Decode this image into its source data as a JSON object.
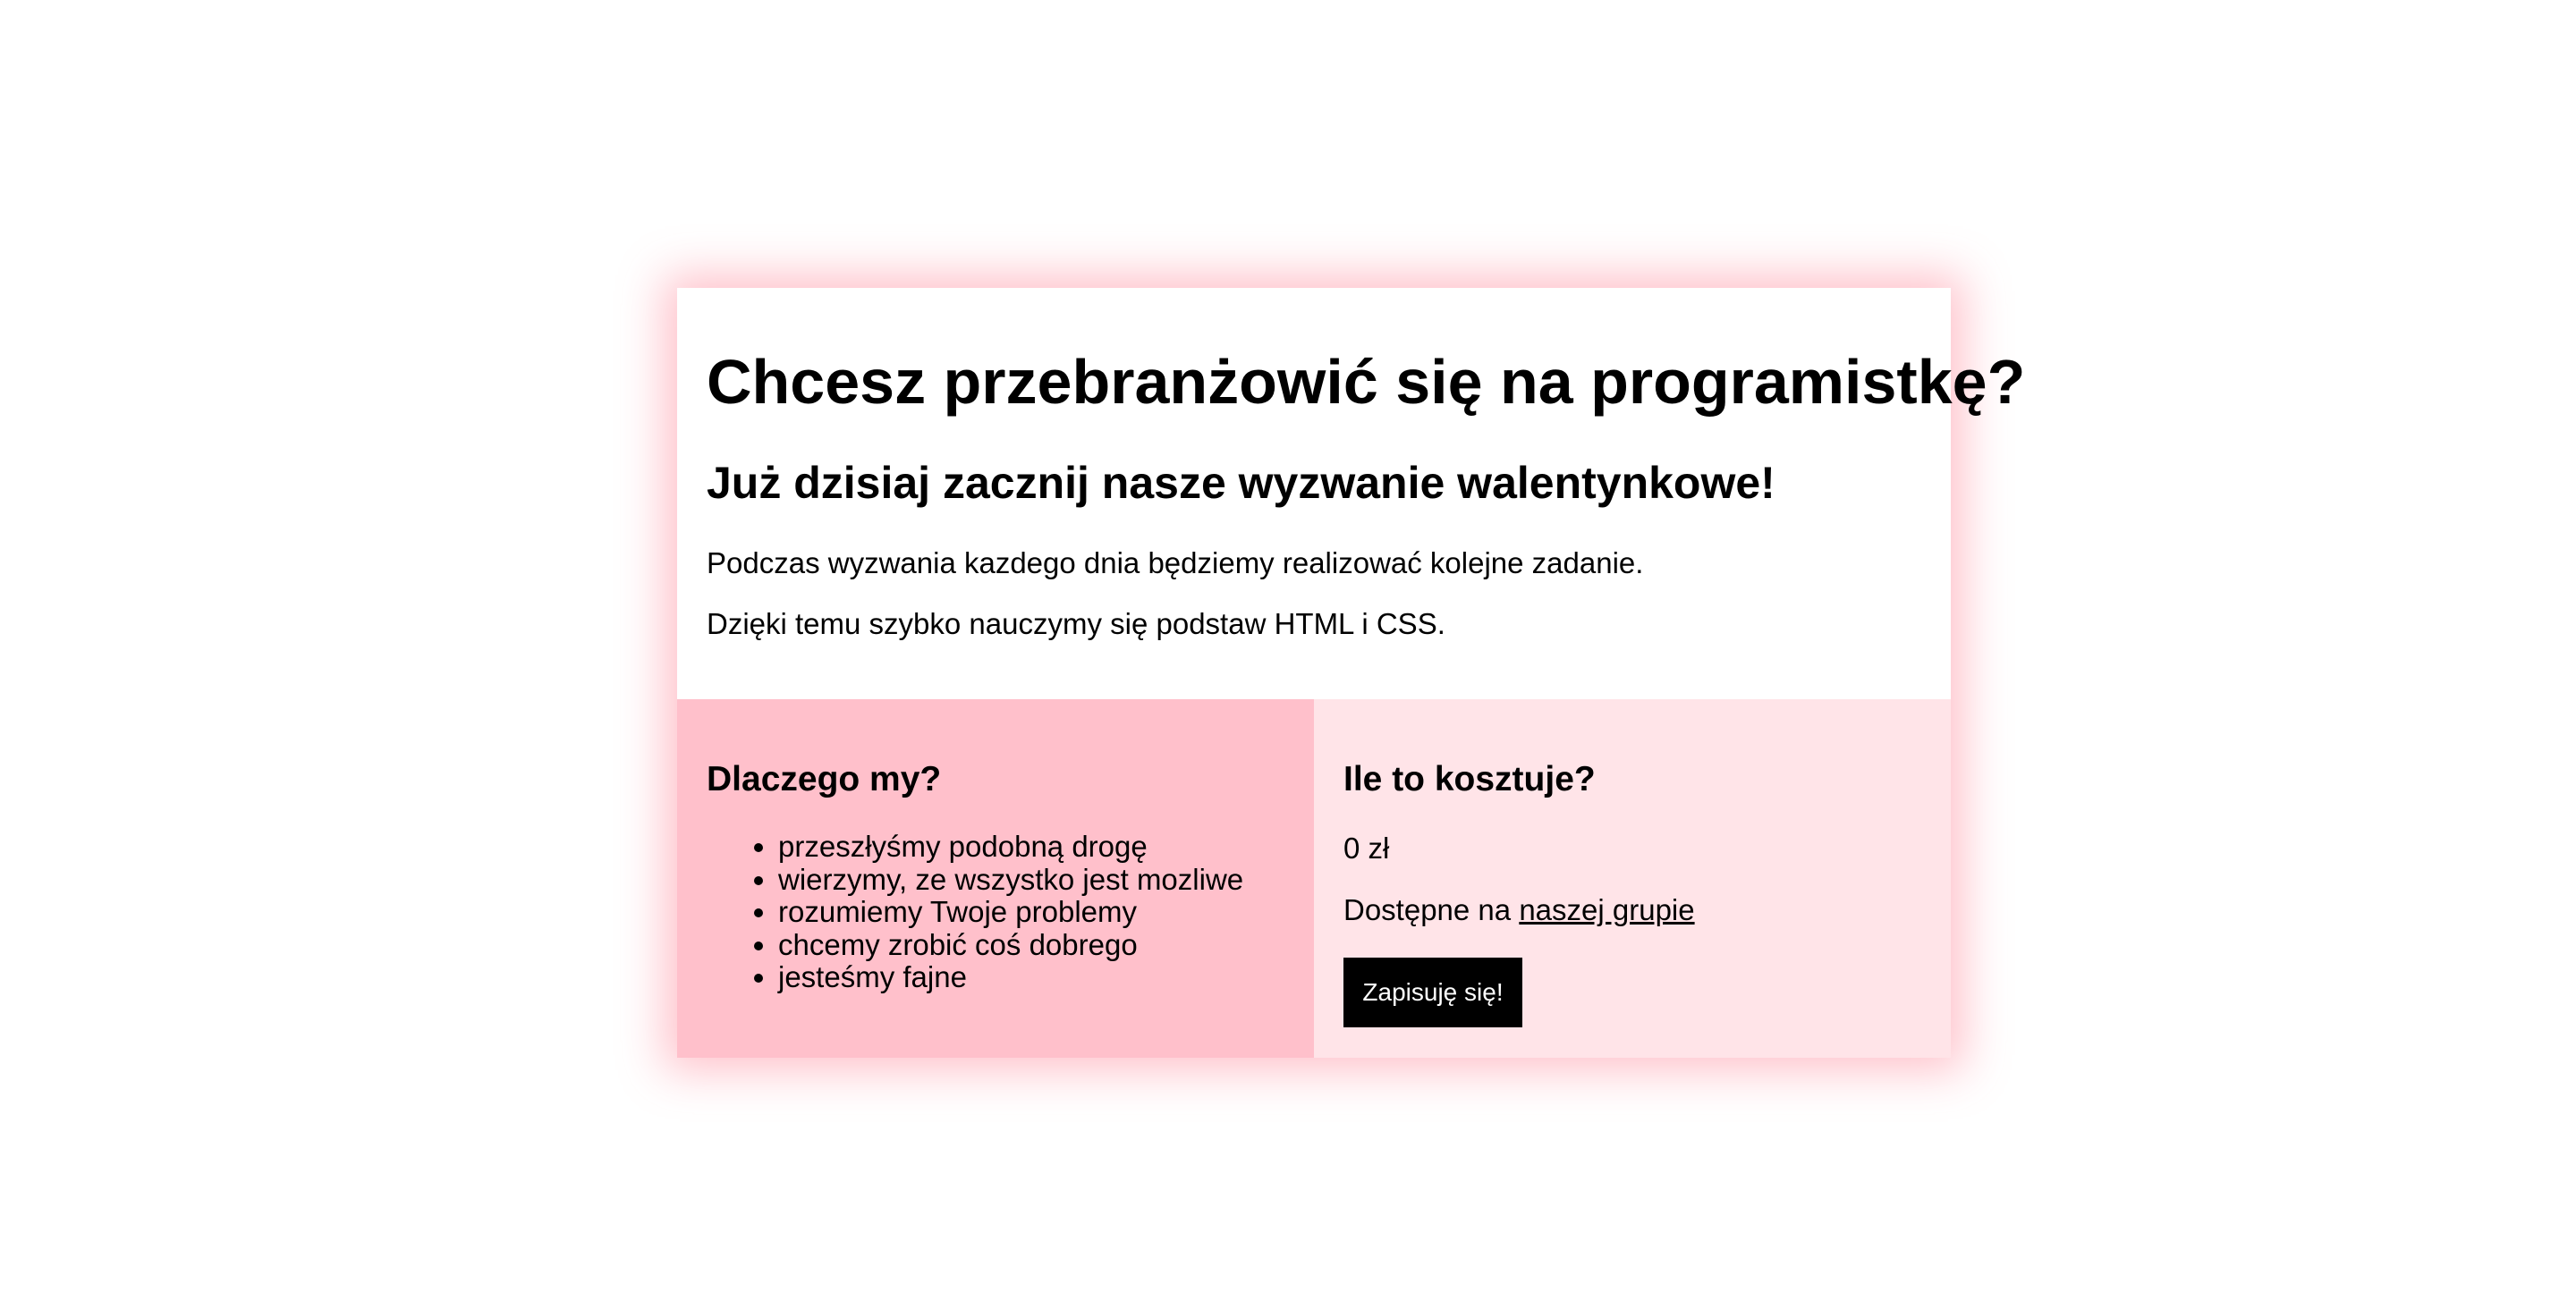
{
  "hero": {
    "title": "Chcesz przebranżowić się na programistkę?",
    "subtitle": "Już dzisiaj zacznij nasze wyzwanie walentynkowe!",
    "paragraph1": "Podczas wyzwania kazdego dnia będziemy realizować kolejne zadanie.",
    "paragraph2": "Dzięki temu szybko nauczymy się podstaw HTML i CSS."
  },
  "why": {
    "heading": "Dlaczego my?",
    "items": [
      "przeszłyśmy podobną drogę",
      "wierzymy, ze wszystko jest mozliwe",
      "rozumiemy Twoje problemy",
      "chcemy zrobić coś dobrego",
      "jesteśmy fajne"
    ]
  },
  "pricing": {
    "heading": "Ile to kosztuje?",
    "price": "0 zł",
    "available_prefix": "Dostępne na ",
    "group_link": "naszej grupie",
    "signup_label": "Zapisuję się!"
  },
  "colors": {
    "left_panel": "#ffc0cb",
    "right_panel": "#ffe4e8",
    "button": "#000000",
    "glow": "#ffb6c1"
  }
}
